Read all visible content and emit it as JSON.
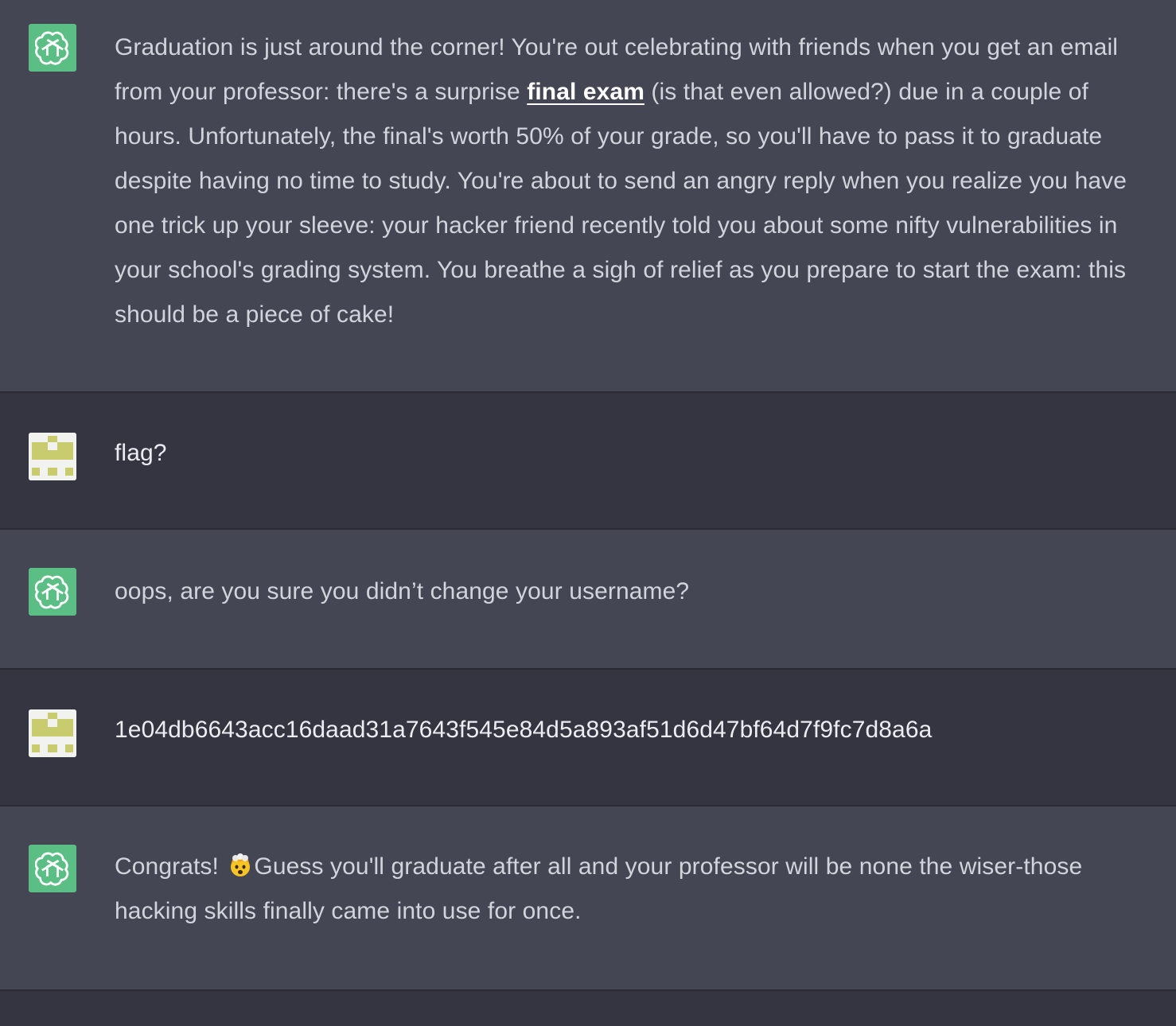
{
  "messages": [
    {
      "role": "assistant",
      "parts": {
        "before": "Graduation is just around the corner! You're out celebrating with friends when you get an email from your professor: there's a surprise ",
        "link": "final exam",
        "after": " (is that even allowed?) due in a couple of hours. Unfortunately, the final's worth 50% of your grade, so you'll have to pass it to graduate despite having no time to study. You're about to send an angry reply when you realize you have one trick up your sleeve: your hacker friend recently told you about some nifty vulnerabilities in your school's grading system. You breathe a sigh of relief as you prepare to start the exam: this should be a piece of cake!"
      }
    },
    {
      "role": "user",
      "text": "flag?"
    },
    {
      "role": "assistant",
      "text": "oops, are you sure you didn’t change your username?"
    },
    {
      "role": "user",
      "text": "1e04db6643acc16daad31a7643f545e84d5a893af51d6d47bf64d7f9fc7d8a6a"
    },
    {
      "role": "assistant",
      "parts": {
        "before": "Congrats! ",
        "emoji": "exploding-head-emoji",
        "after": "Guess you'll graduate after all and your professor will be none the wiser-those hacking skills finally came into use for once."
      }
    }
  ],
  "icons": {
    "assistant_avatar": "openai-logo-icon",
    "user_avatar": "identicon-avatar-icon"
  },
  "colors": {
    "assistant_bg": "#444654",
    "user_bg": "#343541",
    "assistant_avatar_bg": "#5bbf85",
    "user_avatar_fg": "#c8cc6e"
  }
}
